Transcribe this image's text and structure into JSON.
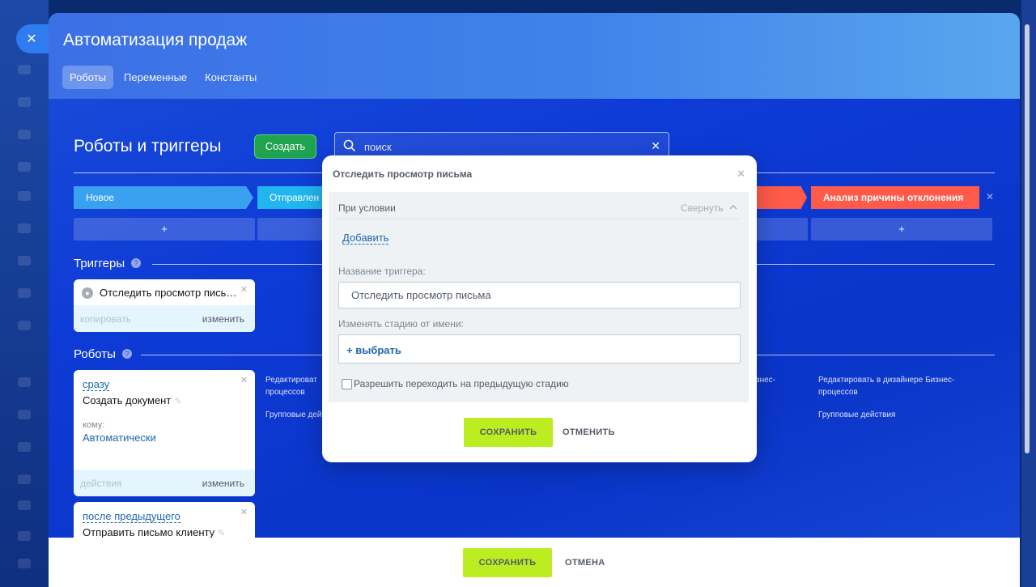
{
  "app": {
    "title": "Автоматизация продаж",
    "tabs": [
      "Роботы",
      "Переменные",
      "Константы"
    ]
  },
  "main": {
    "heading": "Роботы и триггеры",
    "create_label": "Создать",
    "search_placeholder": "поиск"
  },
  "stages": {
    "first": "Новое",
    "second": "Отправлен",
    "last": "Анализ причины отклонения",
    "add": "+"
  },
  "triggers": {
    "label": "Триггеры",
    "card": {
      "title": "Отследить просмотр пись…",
      "copy": "копировать",
      "edit": "изменить"
    }
  },
  "robots": {
    "label": "Роботы",
    "card1": {
      "timing": "сразу",
      "title": "Создать документ",
      "to_label": "кому:",
      "to_value": "Автоматически",
      "actions": "действия",
      "edit": "изменить"
    },
    "card2": {
      "timing": "после предыдущего",
      "title": "Отправить письмо клиенту"
    }
  },
  "background_links": {
    "edit_short": "Редактироват",
    "processes": "процессов",
    "group_short": "Групповые дей",
    "business_tail": "знес-",
    "edit_full": "Редактировать в дизайнере Бизнес-",
    "group_full": "Групповые действия"
  },
  "modal": {
    "title": "Отследить просмотр письма",
    "condition": "При условии",
    "collapse": "Свернуть",
    "add": "Добавить",
    "trigger_name_label": "Название триггера:",
    "trigger_name_value": "Отследить просмотр письма",
    "stage_label": "Изменять стадию от имени:",
    "pick": "+ выбрать",
    "allow_prev": "Разрешить переходить на предыдущую стадию",
    "save": "СОХРАНИТЬ",
    "cancel": "ОТМЕНИТЬ"
  },
  "footer": {
    "save": "СОХРАНИТЬ",
    "cancel": "ОТМЕНА"
  },
  "colors": {
    "accent_green": "#bbed21",
    "create_green": "#1fa34f",
    "stage_blue": "#3aa1f0",
    "stage_red": "#ff5a4a",
    "link_blue": "#2067b0"
  }
}
